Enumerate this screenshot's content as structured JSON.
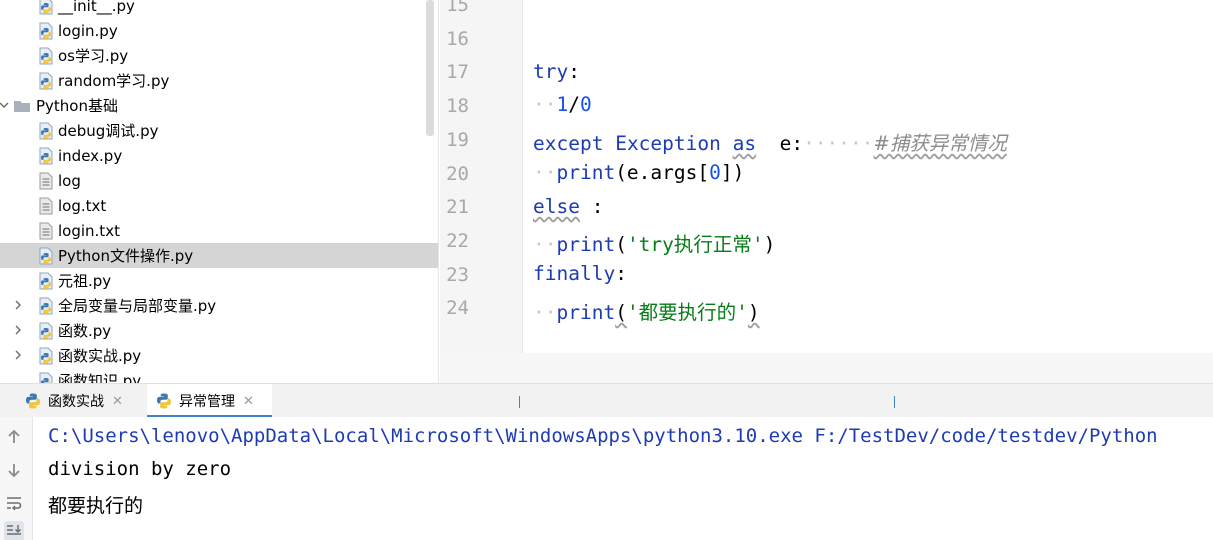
{
  "tree": {
    "items": [
      {
        "label": "__init__.py",
        "type": "py",
        "indent": 2
      },
      {
        "label": "login.py",
        "type": "py",
        "indent": 2
      },
      {
        "label": "os学习.py",
        "type": "py",
        "indent": 2
      },
      {
        "label": "random学习.py",
        "type": "py",
        "indent": 2
      },
      {
        "label": "Python基础",
        "type": "folder",
        "indent": 1,
        "expanded": true
      },
      {
        "label": "debug调试.py",
        "type": "py",
        "indent": 2
      },
      {
        "label": "index.py",
        "type": "py",
        "indent": 2
      },
      {
        "label": "log",
        "type": "text",
        "indent": 2
      },
      {
        "label": "log.txt",
        "type": "text",
        "indent": 2
      },
      {
        "label": "login.txt",
        "type": "text",
        "indent": 2
      },
      {
        "label": "Python文件操作.py",
        "type": "py",
        "indent": 2,
        "selected": true
      },
      {
        "label": "元祖.py",
        "type": "py",
        "indent": 2
      },
      {
        "label": "全局变量与局部变量.py",
        "type": "py",
        "indent": 2,
        "collapsed": true
      },
      {
        "label": "函数.py",
        "type": "py",
        "indent": 2,
        "collapsed": true
      },
      {
        "label": "函数实战.py",
        "type": "py",
        "indent": 2,
        "collapsed": true
      },
      {
        "label": "函数知识.py",
        "type": "py",
        "indent": 2
      }
    ]
  },
  "editor": {
    "line_numbers": [
      "15",
      "16",
      "17",
      "18",
      "19",
      "20",
      "21",
      "22",
      "23",
      "24"
    ],
    "code": {
      "l17_try": "try",
      "l17_colon": ":",
      "l18_ws": "··",
      "l18_num1": "1",
      "l18_slash": "/",
      "l18_num2": "0",
      "l19_except": "except",
      "l19_exc": "Exception",
      "l19_as": "as",
      "l19_e": "e:",
      "l19_ws": "······",
      "l19_comment": "#捕获异常情况",
      "l20_ws": "··",
      "l20_print": "print",
      "l20_args": "(e.args[",
      "l20_idx": "0",
      "l20_close": "])",
      "l21_else": "else",
      "l21_colon": ":",
      "l22_ws": "··",
      "l22_print": "print",
      "l22_open": "(",
      "l22_str": "'try执行正常'",
      "l22_close": ")",
      "l23_finally": "finally",
      "l23_colon": ":",
      "l24_ws": "··",
      "l24_print": "print",
      "l24_open": "(",
      "l24_str": "'都要执行的'",
      "l24_close": ")"
    }
  },
  "run": {
    "tabs": [
      {
        "label": "函数实战",
        "active": false
      },
      {
        "label": "异常管理",
        "active": true
      }
    ],
    "close_glyph": "✕",
    "side_buttons": [
      "arrow-up-icon",
      "arrow-down-icon",
      "soft-wrap-icon",
      "scroll-to-end-icon"
    ],
    "console": {
      "command": "C:\\Users\\lenovo\\AppData\\Local\\Microsoft\\WindowsApps\\python3.10.exe F:/TestDev/code/testdev/Python",
      "out1": "division by zero",
      "out2": "都要执行的"
    }
  },
  "colors": {
    "keyword": "#1d3bb4",
    "number": "#1750eb",
    "string": "#067d17",
    "comment": "#8c8c8c",
    "selection": "#d5d5d5",
    "tab_accent": "#4083c9"
  }
}
